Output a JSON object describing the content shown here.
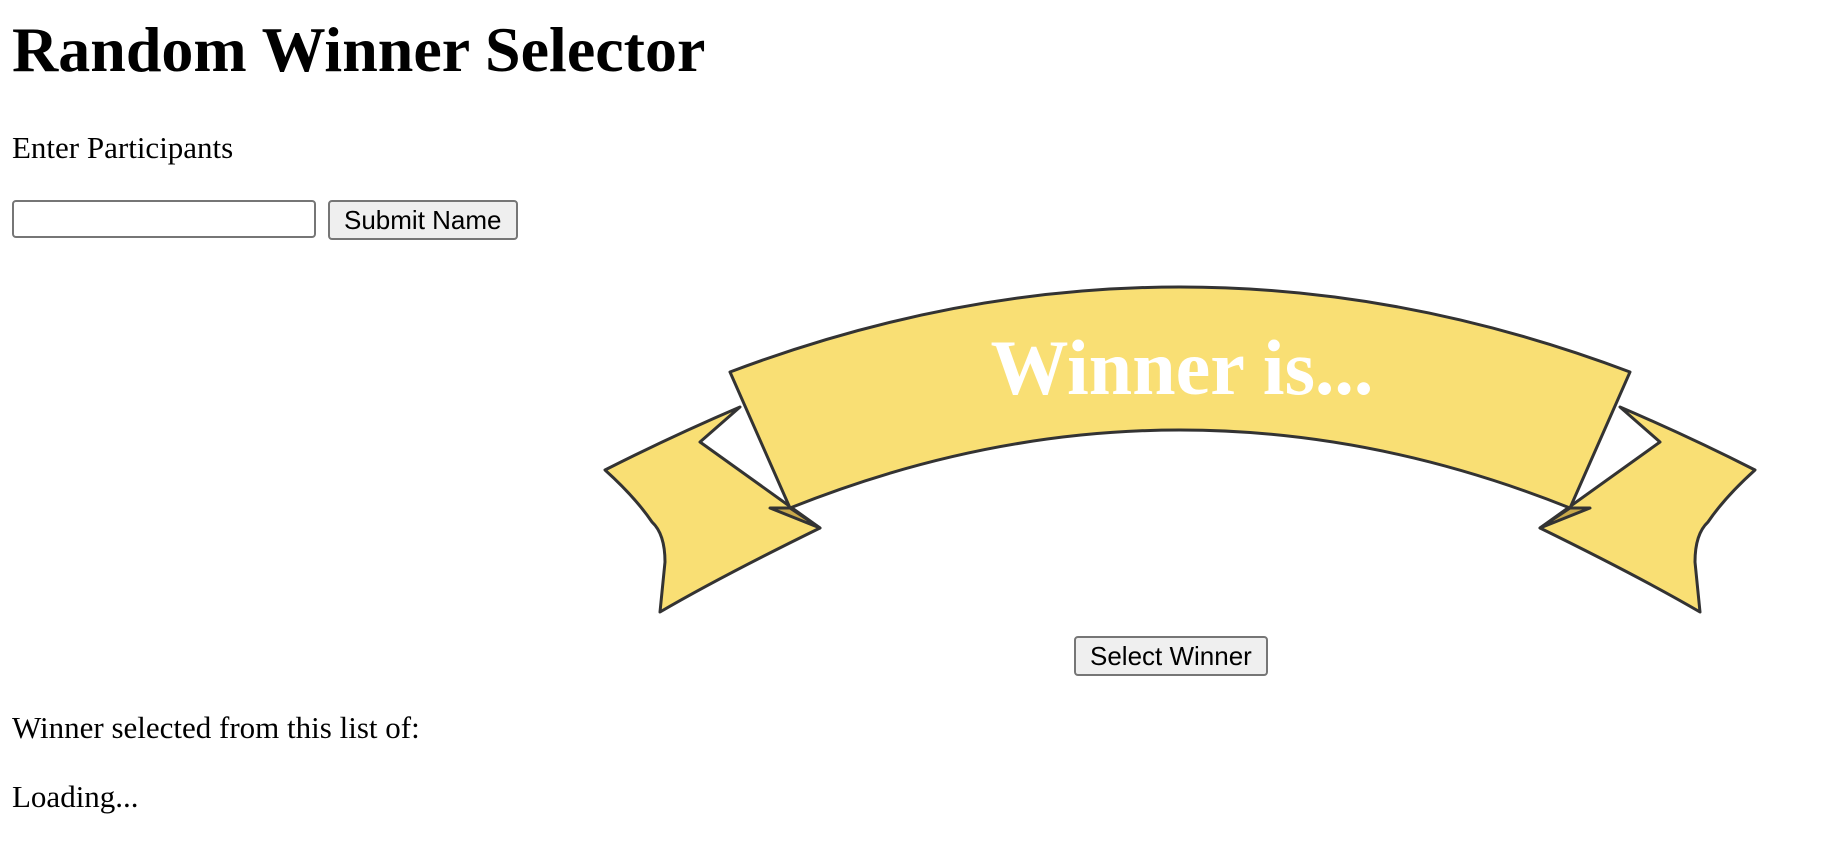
{
  "header": {
    "title": "Random Winner Selector"
  },
  "participants": {
    "section_label": "Enter Participants",
    "input_value": "",
    "submit_label": "Submit Name"
  },
  "banner": {
    "text": "Winner is...",
    "fill_color": "#f9df74",
    "outline_color": "#333333"
  },
  "actions": {
    "select_winner_label": "Select Winner"
  },
  "results": {
    "list_caption": "Winner selected from this list of:",
    "status_text": "Loading..."
  }
}
